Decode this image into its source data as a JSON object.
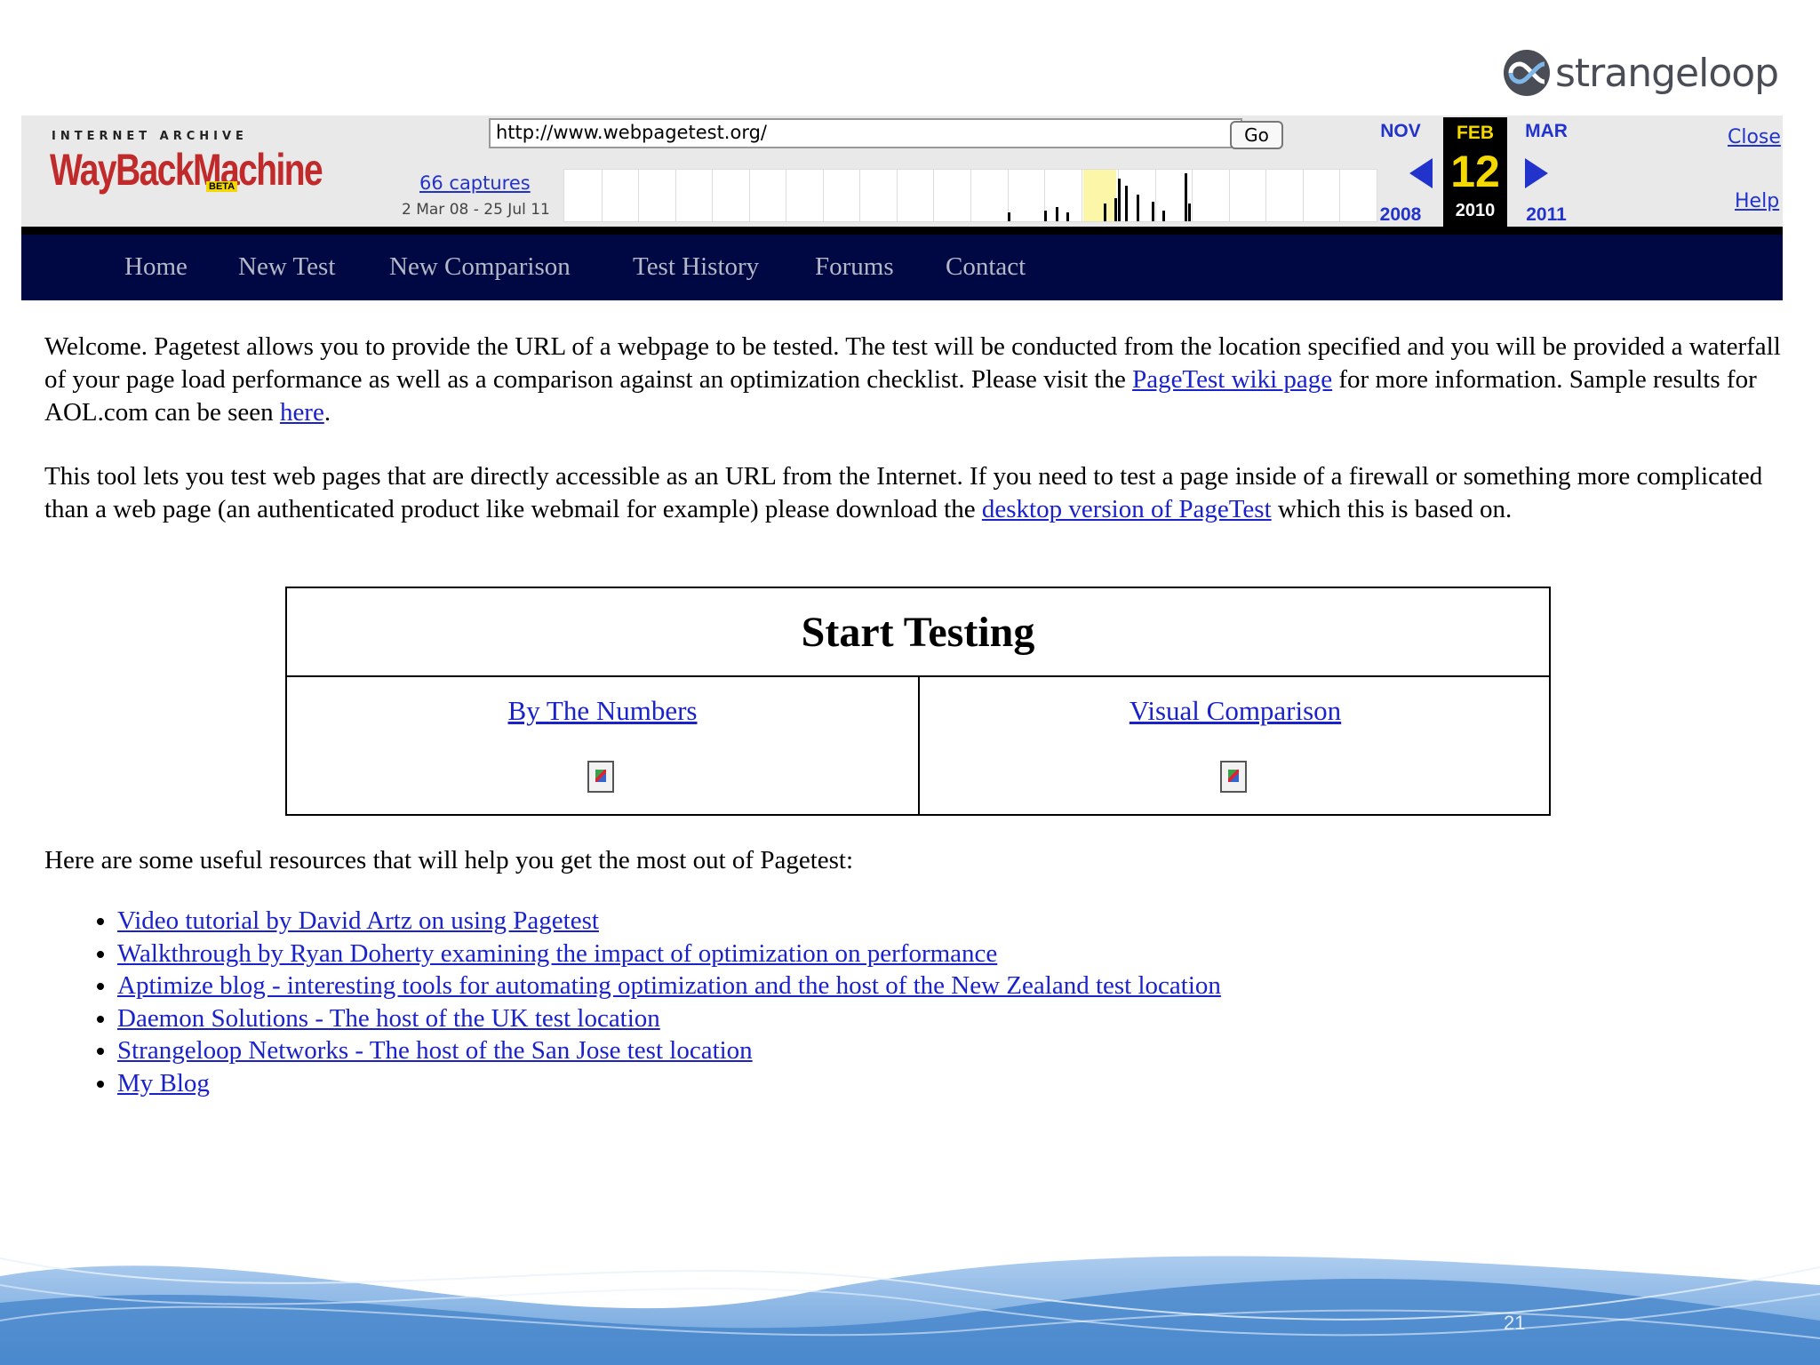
{
  "slide": {
    "logo_text": "strangeloop",
    "page_number": "21"
  },
  "wayback": {
    "brand_top": "INTERNET ARCHIVE",
    "brand_logo": "WayBackMachine",
    "brand_badge": "BETA",
    "url": "http://www.webpagetest.org/",
    "go_label": "Go",
    "captures_link": "66 captures",
    "capture_range": "2 Mar 08 - 25 Jul 11",
    "prev_month": "NOV",
    "prev_year": "2008",
    "current_month": "FEB",
    "current_day": "12",
    "current_year": "2010",
    "next_month": "MAR",
    "next_year": "2011",
    "close_label": "Close",
    "help_label": "Help"
  },
  "nav": [
    "Home",
    "New Test",
    "New Comparison",
    "Test History",
    "Forums",
    "Contact"
  ],
  "welcome": {
    "text1": "Welcome. Pagetest allows you to provide the URL of a webpage to be tested. The test will be conducted from the location specified and you will be provided a waterfall of your page load performance as well as a comparison against an optimization checklist. Please visit the ",
    "wiki_link": "PageTest wiki page",
    "text2": " for more information. Sample results for AOL.com can be seen ",
    "here_link": "here",
    "text3": "."
  },
  "tool": {
    "text1": "This tool lets you test web pages that are directly accessible as an URL from the Internet. If you need to test a page inside of a firewall or something more complicated than a web page (an authenticated product like webmail for example) please download the ",
    "desktop_link": "desktop version of PageTest",
    "text2": " which this is based on."
  },
  "start_testing": {
    "title": "Start Testing",
    "left_link": "By The Numbers",
    "right_link": "Visual Comparison"
  },
  "resources": {
    "intro": "Here are some useful resources that will help you get the most out of Pagetest:",
    "links": [
      "Video tutorial by David Artz on using Pagetest",
      "Walkthrough by Ryan Doherty examining the impact of optimization on performance",
      "Aptimize blog - interesting tools for automating optimization and the host of the New Zealand test location",
      "Daemon Solutions - The host of the UK test location",
      "Strangeloop Networks - The host of the San Jose test location",
      "My Blog"
    ]
  },
  "colors": {
    "navbar": "#000844",
    "link": "#1a22cc",
    "wayback_highlight": "#f5d800"
  },
  "icons": [
    "strangeloop-logo-icon",
    "prev-arrow-icon",
    "next-arrow-icon",
    "broken-image-icon"
  ]
}
